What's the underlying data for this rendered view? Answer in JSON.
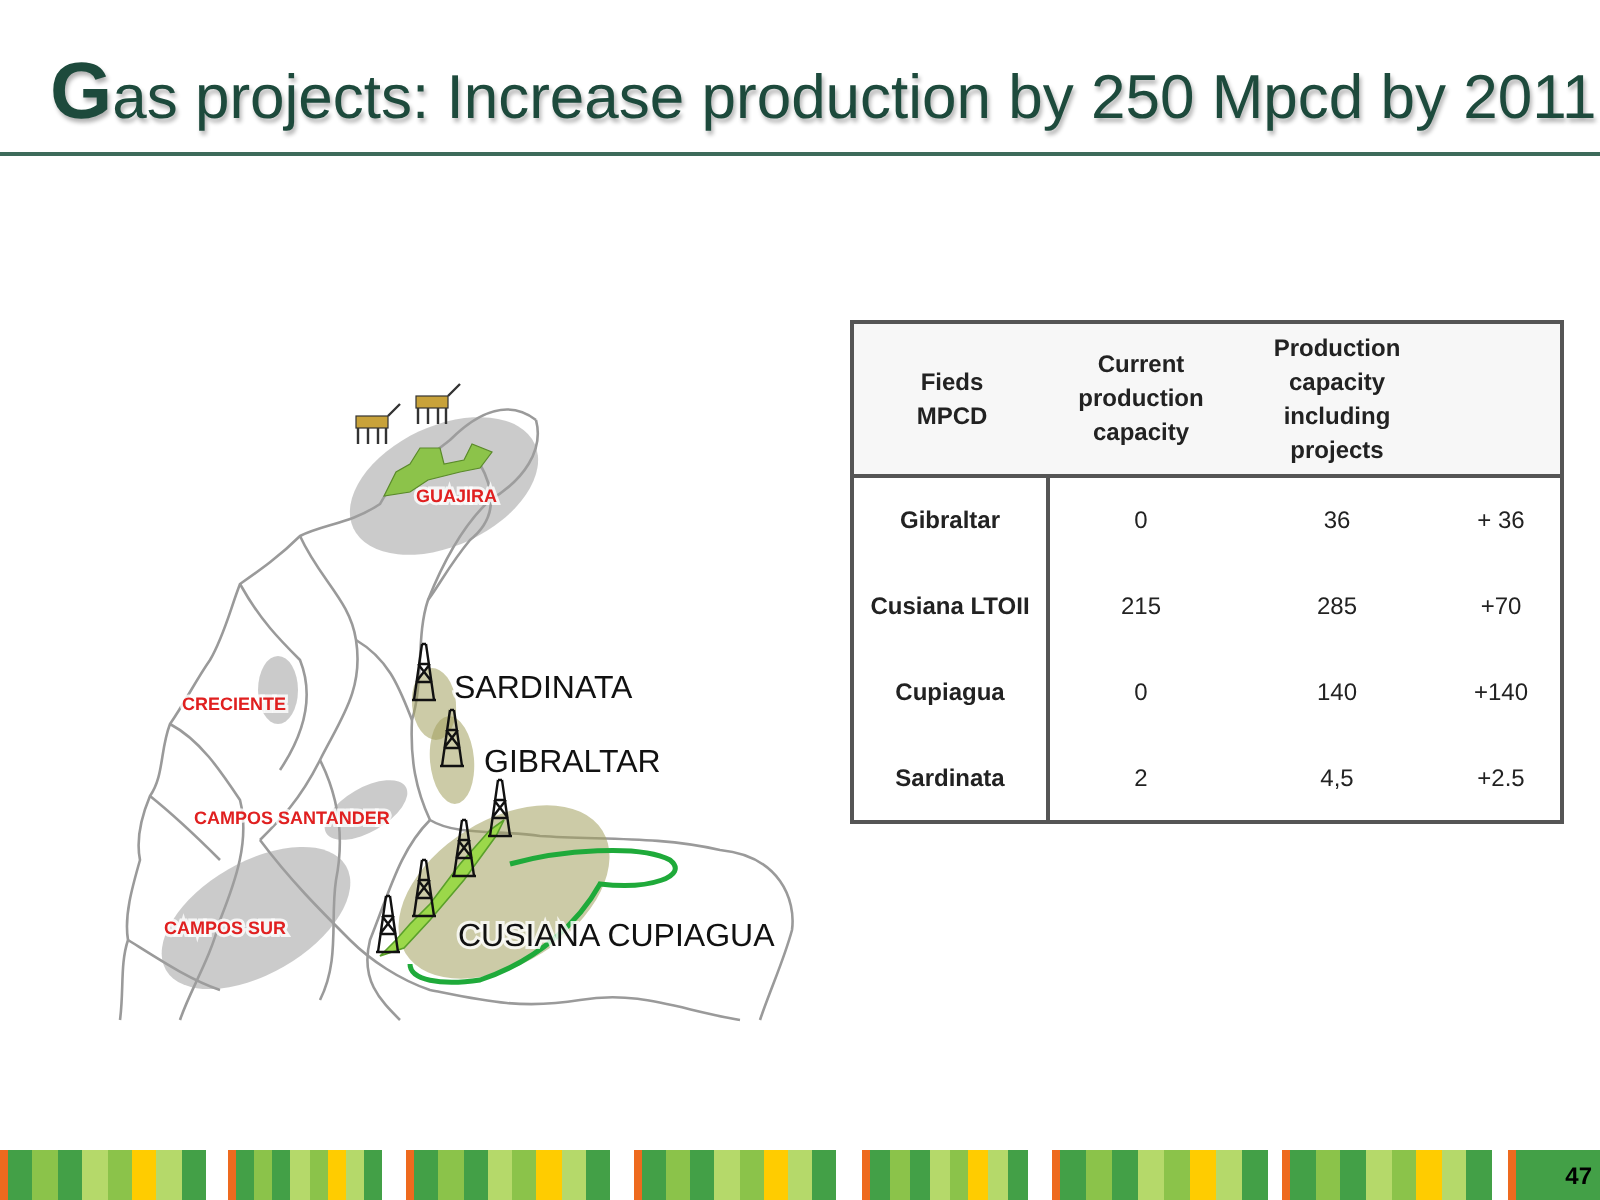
{
  "title": "Gas projects: Increase production by 250 Mpcd by 2011",
  "map": {
    "labels": [
      {
        "text": "GUAJIRA",
        "kind": "basin"
      },
      {
        "text": "CRECIENTE",
        "kind": "basin"
      },
      {
        "text": "CAMPOS SANTANDER",
        "kind": "basin"
      },
      {
        "text": "CAMPOS SUR",
        "kind": "basin"
      },
      {
        "text": "SARDINATA",
        "kind": "field"
      },
      {
        "text": "GIBRALTAR",
        "kind": "field"
      },
      {
        "text": "CUSIANA CUPIAGUA",
        "kind": "field"
      }
    ]
  },
  "table": {
    "columns": [
      "Fieds\nMPCD",
      "Current production capacity",
      "Production capacity including projects"
    ],
    "rows": [
      [
        "Gibraltar",
        "0",
        "36",
        "+ 36"
      ],
      [
        "Cusiana LTOII",
        "215",
        "285",
        "+70"
      ],
      [
        "Cupiagua",
        "0",
        "140",
        "+140"
      ],
      [
        "Sardinata",
        "2",
        "4,5",
        "+2.5"
      ]
    ]
  },
  "page_number": "47"
}
